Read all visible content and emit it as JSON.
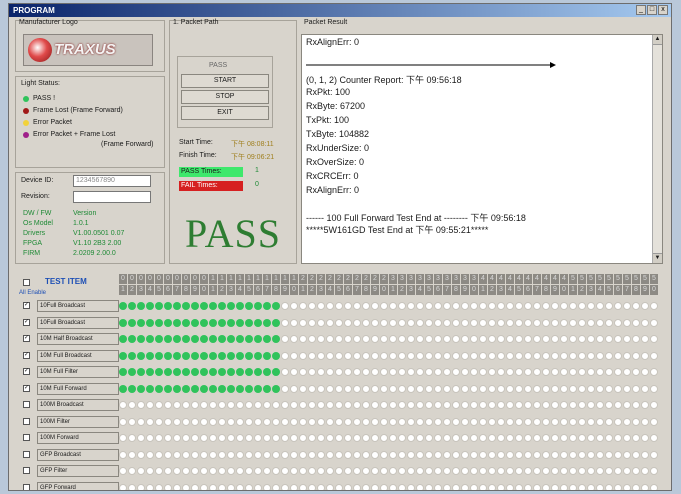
{
  "window": {
    "title": "PROGRAM",
    "min": "_",
    "max": "□",
    "close": "x"
  },
  "logo_group": {
    "label": "Manufacturer Logo",
    "wordmark": "TRAXUS"
  },
  "light_status": {
    "label": "Light Status:",
    "items": [
      {
        "label": "PASS !",
        "color": "#2fc35b"
      },
      {
        "label": "Frame Lost (Frame Forward)",
        "color": "#a01818"
      },
      {
        "label": "Error Packet",
        "color": "#f2d23a"
      },
      {
        "label": "Error Packet + Frame Lost",
        "label2": "(Frame Forward)",
        "color": "#a0208a"
      }
    ]
  },
  "fields": {
    "serial_label": "Device ID:",
    "serial_value": "1234567890",
    "revision_label": "Revision:",
    "revision_value": ""
  },
  "versions": [
    {
      "k": "DW / FW",
      "v": "Version"
    },
    {
      "k": "Os Model",
      "v": "1.0.1"
    },
    {
      "k": "Drivers",
      "v": "V1.00.0501 0.07"
    },
    {
      "k": "FPGA",
      "v": "V1.10 2B3 2.00"
    },
    {
      "k": "FIRM",
      "v": "2.0209 2.00.0"
    }
  ],
  "packet_path": {
    "label": "1. Packet Path",
    "small_label": "PASS",
    "buttons": {
      "start": "START",
      "stop": "STOP",
      "exit": "EXIT"
    },
    "start_time_label": "Start Time:",
    "start_time": "下午 08:08:11",
    "finish_time_label": "Finish Time:",
    "finish_time": "下午 09:06:21",
    "pass_times_label": "PASS Times:",
    "pass_times": "1",
    "fail_times_label": "FAIL Times:",
    "fail_times": "0",
    "result_big": "PASS"
  },
  "packet_result": {
    "label": "Packet Result",
    "lines": [
      "RxAlignErr: 0",
      "(0, 1, 2) Counter Report: 下午 09:56:18",
      "RxPkt: 100",
      "RxByte: 67200",
      "TxPkt: 100",
      "TxByte: 104882",
      "RxUnderSize: 0",
      "RxOverSize: 0",
      "RxCRCErr: 0",
      "RxAlignErr: 0",
      "------ 100 Full Forward Test End at -------- 下午 09:56:18",
      "*****5W161GD Test End at 下午 09:55:21*****"
    ]
  },
  "tests": {
    "header_label": "TEST ITEM",
    "enable_label": "All Enable",
    "columns": 60,
    "header_row1": "000000000011111111112222222222333333333344444444445555555555",
    "header_row2": "123456789012345678901234567890123456789012345678901234567890",
    "items": [
      {
        "label": "10Full Broadcast",
        "checked": true,
        "pass": 18
      },
      {
        "label": "10Full Broadcast",
        "checked": true,
        "pass": 18
      },
      {
        "label": "10M Half Broadcast",
        "checked": true,
        "pass": 18
      },
      {
        "label": "10M Full Broadcast",
        "checked": true,
        "pass": 18
      },
      {
        "label": "10M Full Filter",
        "checked": true,
        "pass": 18
      },
      {
        "label": "10M Full Forward",
        "checked": true,
        "pass": 18
      },
      {
        "label": "100M Broadcast",
        "checked": false,
        "pass": 0
      },
      {
        "label": "100M Filter",
        "checked": false,
        "pass": 0
      },
      {
        "label": "100M Forward",
        "checked": false,
        "pass": 0
      },
      {
        "label": "GFP Broadcast",
        "checked": false,
        "pass": 0
      },
      {
        "label": "GFP Filter",
        "checked": false,
        "pass": 0
      },
      {
        "label": "GFP Forward",
        "checked": false,
        "pass": 0
      }
    ]
  }
}
